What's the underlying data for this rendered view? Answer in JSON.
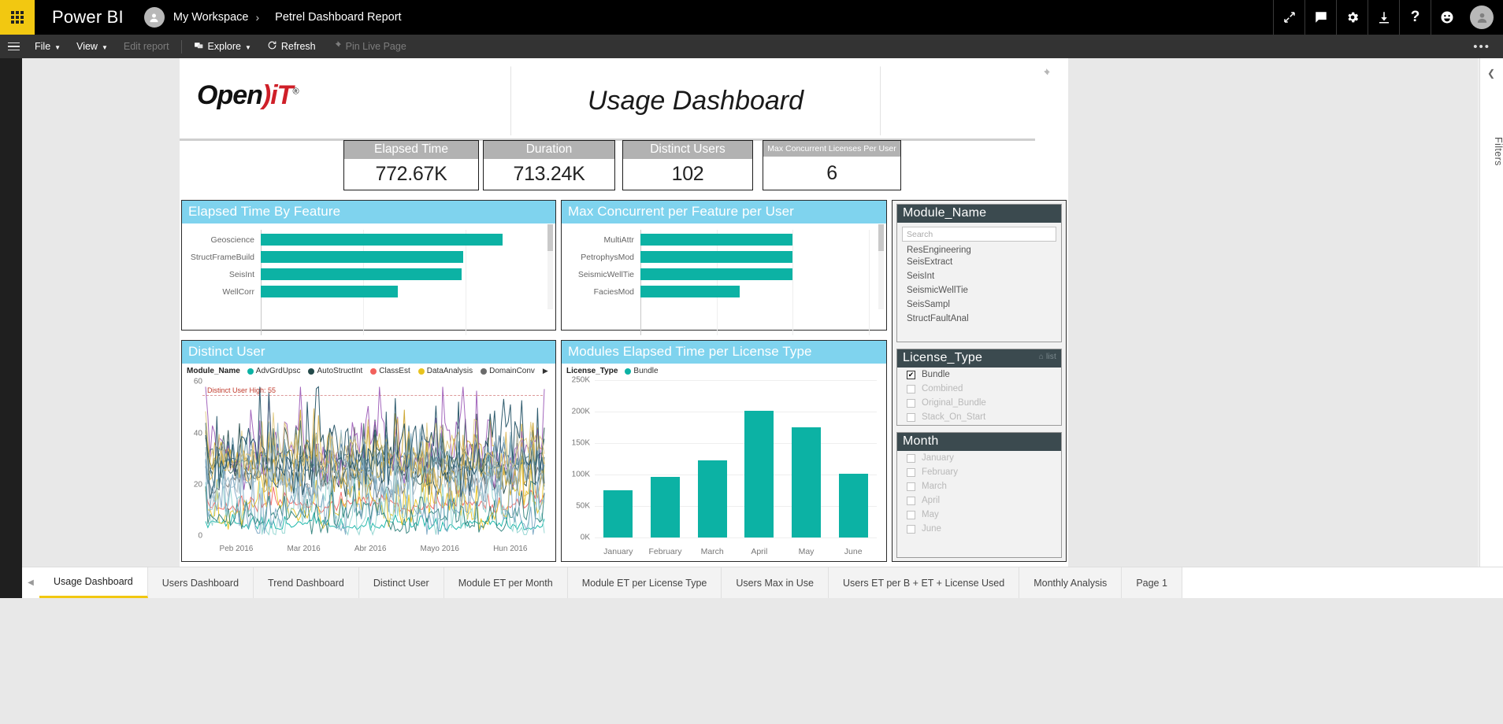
{
  "app": {
    "brand": "Power BI",
    "workspace": "My Workspace",
    "report_name": "Petrel Dashboard Report",
    "breadcrumb_separator": "›",
    "accent_yellow": "#f2c811",
    "teal": "#0cb2a4",
    "panel_title_blue": "#7fd3ee",
    "slicer_header": "#3b4a4f"
  },
  "topbar_icons": [
    {
      "name": "fullscreen-icon"
    },
    {
      "name": "comment-icon"
    },
    {
      "name": "gear-icon"
    },
    {
      "name": "download-icon"
    },
    {
      "name": "help-icon",
      "glyph": "?"
    },
    {
      "name": "smiley-feedback-icon"
    }
  ],
  "menu": {
    "file": "File",
    "view": "View",
    "edit_report": "Edit report",
    "explore": "Explore",
    "refresh": "Refresh",
    "pin_live_page": "Pin Live Page",
    "more": "•••"
  },
  "filters_panel": {
    "label": "Filters"
  },
  "report": {
    "logo": {
      "open": "Open",
      "it": "iT",
      "registered": "®"
    },
    "title": "Usage Dashboard",
    "kpis": [
      {
        "label": "Elapsed Time",
        "value": "772.67K"
      },
      {
        "label": "Duration",
        "value": "713.24K"
      },
      {
        "label": "Distinct Users",
        "value": "102"
      },
      {
        "label": "Max Concurrent Licenses Per User",
        "value": "6"
      }
    ]
  },
  "chart_data": [
    {
      "type": "bar",
      "orientation": "horizontal",
      "title": "Elapsed Time By Feature",
      "categories": [
        "Geoscience",
        "StructFrameBuild",
        "SeisInt",
        "WellCorr"
      ],
      "values": [
        118000,
        99000,
        98000,
        67000
      ],
      "xlabel": "",
      "ylabel": "",
      "xlim": [
        0,
        125000
      ],
      "tick_labels": [
        "0K",
        "50K",
        "100K"
      ],
      "tick_values": [
        0,
        50000,
        100000
      ],
      "grid": true,
      "scrollable": true
    },
    {
      "type": "bar",
      "orientation": "horizontal",
      "title": "Max Concurrent per Feature per User",
      "categories": [
        "MultiAttr",
        "PetrophysMod",
        "SeismicWellTie",
        "FaciesMod"
      ],
      "values": [
        4,
        4,
        4,
        2.6
      ],
      "xlabel": "",
      "ylabel": "",
      "xlim": [
        0,
        6
      ],
      "tick_labels": [
        "0",
        "2",
        "4",
        "6"
      ],
      "tick_values": [
        0,
        2,
        4,
        6
      ],
      "grid": true,
      "scrollable": true
    },
    {
      "type": "line",
      "title": "Distinct User",
      "legend_title": "Module_Name",
      "legend": [
        {
          "name": "AdvGrdUpsc",
          "color": "#0cb2a4"
        },
        {
          "name": "AutoStructInt",
          "color": "#244a4a"
        },
        {
          "name": "ClassEst",
          "color": "#f2615c"
        },
        {
          "name": "DataAnalysis",
          "color": "#e8c31e"
        },
        {
          "name": "DomainConv",
          "color": "#6b6b6b"
        }
      ],
      "legend_overflow": "▶",
      "reference_line": {
        "label": "Distinct User High: 55",
        "value": 55,
        "color": "#c0392b"
      },
      "ylim": [
        0,
        60
      ],
      "ytick_labels": [
        "0",
        "20",
        "40",
        "60"
      ],
      "ytick_values": [
        0,
        20,
        40,
        60
      ],
      "xtick_labels": [
        "Peb 2016",
        "Mar 2016",
        "Abr 2016",
        "Mayo 2016",
        "Hun 2016"
      ],
      "xlabel": "",
      "ylabel": "",
      "grid": false
    },
    {
      "type": "bar",
      "orientation": "vertical",
      "title": "Modules Elapsed Time per License Type",
      "legend_title": "License_Type",
      "legend": [
        {
          "name": "Bundle",
          "color": "#0cb2a4"
        }
      ],
      "categories": [
        "January",
        "February",
        "March",
        "April",
        "May",
        "June"
      ],
      "values": [
        75000,
        97000,
        123000,
        202000,
        175000,
        102000
      ],
      "xlabel": "",
      "ylabel": "",
      "ylim": [
        0,
        250000
      ],
      "ytick_labels": [
        "0K",
        "50K",
        "100K",
        "150K",
        "200K",
        "250K"
      ],
      "ytick_values": [
        0,
        50000,
        100000,
        150000,
        200000,
        250000
      ],
      "grid": true
    }
  ],
  "slicers": [
    {
      "name": "module-name-slicer",
      "title": "Module_Name",
      "search_placeholder": "Search",
      "clipped_first": "ResEngineering",
      "items": [
        {
          "label": "SeisExtract",
          "checked": false
        },
        {
          "label": "SeisInt",
          "checked": false
        },
        {
          "label": "SeismicWellTie",
          "checked": false
        },
        {
          "label": "SeisSampl",
          "checked": false
        },
        {
          "label": "StructFaultAnal",
          "checked": false
        }
      ]
    },
    {
      "name": "license-type-slicer",
      "title": "License_Type",
      "tools": "⌂ list",
      "items": [
        {
          "label": "Bundle",
          "checked": true
        },
        {
          "label": "Combined",
          "checked": false
        },
        {
          "label": "Original_Bundle",
          "checked": false
        },
        {
          "label": "Stack_On_Start",
          "checked": false
        }
      ]
    },
    {
      "name": "month-slicer",
      "title": "Month",
      "items": [
        {
          "label": "January",
          "checked": false
        },
        {
          "label": "February",
          "checked": false
        },
        {
          "label": "March",
          "checked": false
        },
        {
          "label": "April",
          "checked": false
        },
        {
          "label": "May",
          "checked": false
        },
        {
          "label": "June",
          "checked": false
        }
      ]
    }
  ],
  "tabs": [
    {
      "label": "Usage Dashboard",
      "active": true
    },
    {
      "label": "Users Dashboard",
      "active": false
    },
    {
      "label": "Trend Dashboard",
      "active": false
    },
    {
      "label": "Distinct User",
      "active": false
    },
    {
      "label": "Module ET per Month",
      "active": false
    },
    {
      "label": "Module ET per License Type",
      "active": false
    },
    {
      "label": "Users Max in Use",
      "active": false
    },
    {
      "label": "Users ET per B + ET + License Used",
      "active": false
    },
    {
      "label": "Monthly Analysis",
      "active": false
    },
    {
      "label": "Page 1",
      "active": false
    }
  ]
}
